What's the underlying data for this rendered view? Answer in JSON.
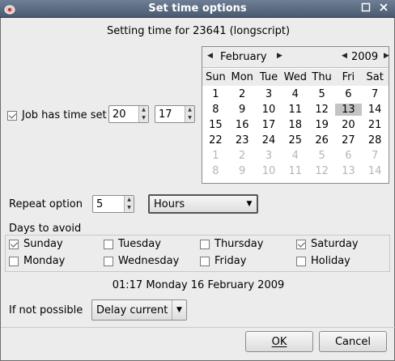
{
  "window": {
    "title": "Set time options",
    "minimize_icon": "square-icon",
    "close_icon": "close-icon"
  },
  "heading": "Setting time for 23641 (longscript)",
  "time": {
    "checkbox_label": "Job has time set",
    "checked": true,
    "hour": "20",
    "minute": "17"
  },
  "calendar": {
    "month": "February",
    "year": "2009",
    "day_headers": [
      "Sun",
      "Mon",
      "Tue",
      "Wed",
      "Thu",
      "Fri",
      "Sat"
    ],
    "weeks": [
      [
        "1",
        "2",
        "3",
        "4",
        "5",
        "6",
        "7"
      ],
      [
        "8",
        "9",
        "10",
        "11",
        "12",
        "13",
        "14"
      ],
      [
        "15",
        "16",
        "17",
        "18",
        "19",
        "20",
        "21"
      ],
      [
        "22",
        "23",
        "24",
        "25",
        "26",
        "27",
        "28"
      ],
      [
        "1",
        "2",
        "3",
        "4",
        "5",
        "6",
        "7"
      ],
      [
        "8",
        "9",
        "10",
        "11",
        "12",
        "13",
        "14"
      ]
    ],
    "selected": "13"
  },
  "repeat": {
    "label": "Repeat option",
    "value": "5",
    "unit": "Hours"
  },
  "avoid": {
    "label": "Days to avoid",
    "items": [
      {
        "label": "Sunday",
        "checked": true
      },
      {
        "label": "Tuesday",
        "checked": false
      },
      {
        "label": "Thursday",
        "checked": false
      },
      {
        "label": "Saturday",
        "checked": true
      },
      {
        "label": "Monday",
        "checked": false
      },
      {
        "label": "Wednesday",
        "checked": false
      },
      {
        "label": "Friday",
        "checked": false
      },
      {
        "label": "Holiday",
        "checked": false
      }
    ]
  },
  "summary": "01:17 Monday 16 February 2009",
  "if_not_possible": {
    "label": "If not possible",
    "value": "Delay current"
  },
  "buttons": {
    "ok": "OK",
    "cancel": "Cancel"
  }
}
